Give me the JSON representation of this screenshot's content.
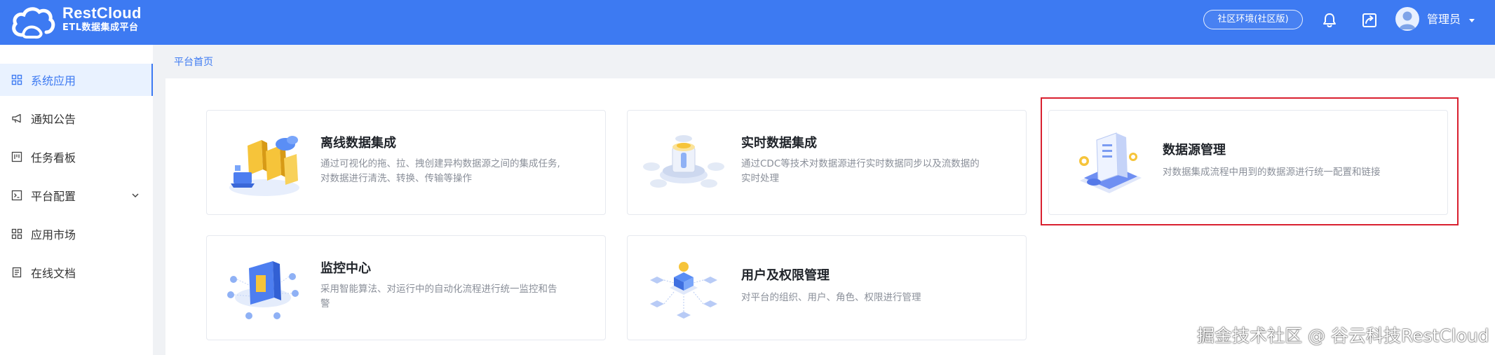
{
  "header": {
    "brand_name": "RestCloud",
    "brand_subtitle": "ETL数据集成平台",
    "environment_badge": "社区环境(社区版)",
    "user_name": "管理员",
    "colors": {
      "header_bg": "#3d7af2",
      "accent": "#3d7af2",
      "highlight": "#d9202f"
    }
  },
  "sidebar": {
    "items": [
      {
        "label": "系统应用",
        "icon": "grid-icon",
        "active": true
      },
      {
        "label": "通知公告",
        "icon": "megaphone-icon"
      },
      {
        "label": "任务看板",
        "icon": "kanban-icon"
      },
      {
        "label": "平台配置",
        "icon": "terminal-icon",
        "expandable": true
      },
      {
        "label": "应用市场",
        "icon": "grid-icon"
      },
      {
        "label": "在线文档",
        "icon": "document-icon"
      }
    ]
  },
  "breadcrumb": "平台首页",
  "cards": [
    {
      "title": "离线数据集成",
      "desc": "通过可视化的拖、拉、拽创建异构数据源之间的集成任务,对数据进行清洗、转换、传输等操作",
      "icon": "etl-illustration"
    },
    {
      "title": "实时数据集成",
      "desc": "通过CDC等技术对数据源进行实时数据同步以及流数据的实时处理",
      "icon": "realtime-illustration"
    },
    {
      "title": "数据源管理",
      "desc": "对数据集成流程中用到的数据源进行统一配置和链接",
      "icon": "datasource-illustration",
      "highlighted": true
    },
    {
      "title": "监控中心",
      "desc": "采用智能算法、对运行中的自动化流程进行统一监控和告警",
      "icon": "monitor-illustration"
    },
    {
      "title": "用户及权限管理",
      "desc": "对平台的组织、用户、角色、权限进行管理",
      "icon": "users-permissions-illustration"
    }
  ],
  "watermark": "掘金技术社区 @ 谷云科技RestCloud"
}
